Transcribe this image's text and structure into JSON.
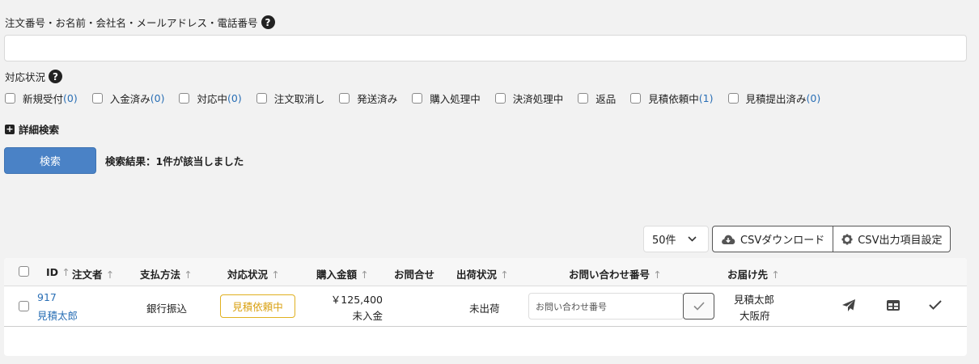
{
  "search": {
    "label": "注文番号・お名前・会社名・メールアドレス・電話番号",
    "value": "",
    "placeholder": ""
  },
  "status_label": "対応状況",
  "statuses": [
    {
      "label": "新規受付",
      "count": "(0)"
    },
    {
      "label": "入金済み",
      "count": "(0)"
    },
    {
      "label": "対応中",
      "count": "(0)"
    },
    {
      "label": "注文取消し",
      "count": ""
    },
    {
      "label": "発送済み",
      "count": ""
    },
    {
      "label": "購入処理中",
      "count": ""
    },
    {
      "label": "決済処理中",
      "count": ""
    },
    {
      "label": "返品",
      "count": ""
    },
    {
      "label": "見積依頼中",
      "count": "(1)"
    },
    {
      "label": "見積提出済み",
      "count": "(0)"
    }
  ],
  "advanced_search": "詳細検索",
  "search_button": "検索",
  "result_text": "検索結果：1件が該当しました",
  "per_page": "50件",
  "csv_download": "CSVダウンロード",
  "csv_settings": "CSV出力項目設定",
  "columns": {
    "id": "ID",
    "customer": "注文者",
    "payment": "支払方法",
    "status": "対応状況",
    "amount": "購入金額",
    "inquiry": "お問合せ",
    "shipping": "出荷状況",
    "inquiry_no": "お問い合わせ番号",
    "destination": "お届け先"
  },
  "rows": [
    {
      "id": "917",
      "customer": "見積太郎",
      "payment": "銀行振込",
      "status": "見積依頼中",
      "amount": "￥125,400",
      "payment_status": "未入金",
      "shipping": "未出荷",
      "inquiry_placeholder": "お問い合わせ番号",
      "dest_name": "見積太郎",
      "dest_pref": "大阪府"
    }
  ],
  "colors": {
    "accent": "#4a82c6",
    "link": "#2a6fb5",
    "badge": "#e0b020"
  }
}
